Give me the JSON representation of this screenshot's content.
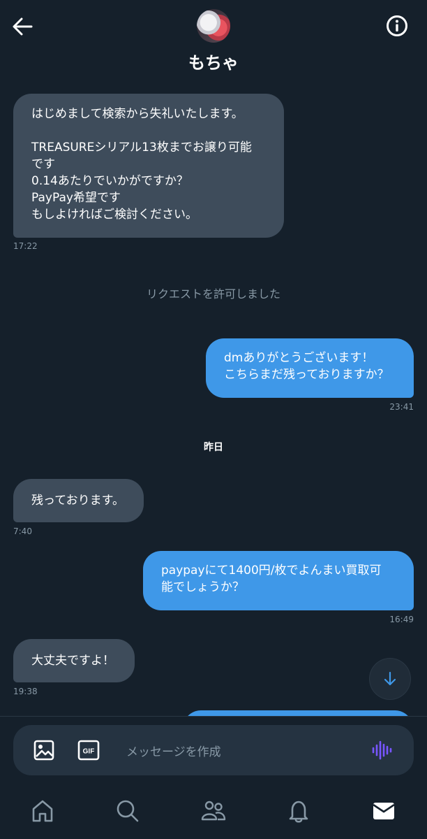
{
  "header": {
    "contact_name": "もちゃ"
  },
  "messages": [
    {
      "text": "はじめまして検索から失礼いたします。\n\nTREASUREシリアル13枚までお譲り可能\nです\n0.14あたりでいかがですか？\nPayPay希望です\nもしよければご検討ください。",
      "time": "17:22",
      "direction": "in"
    },
    {
      "text": "dmありがとうございます！\nこちらまだ残っておりますか？",
      "time": "23:41",
      "direction": "out"
    },
    {
      "text": "残っております。",
      "time": "7:40",
      "direction": "in"
    },
    {
      "text": "paypayにて1400円/枚でよんまい買取可\n能でしょうか？",
      "time": "16:49",
      "direction": "out"
    },
    {
      "text": "大丈夫ですよ！",
      "time": "19:38",
      "direction": "in"
    }
  ],
  "system_message": "リクエストを許可しました",
  "date_separator": "昨日",
  "composer": {
    "placeholder": "メッセージを作成",
    "gif_label": "GIF"
  },
  "icons": {
    "back": "arrow-left-icon",
    "info": "info-icon",
    "image": "image-icon",
    "gif": "gif-icon",
    "voice": "voice-icon",
    "scroll_down": "arrow-down-icon",
    "tabs": [
      "home-icon",
      "search-icon",
      "communities-icon",
      "notifications-icon",
      "messages-icon"
    ]
  },
  "colors": {
    "background": "#15202b",
    "incoming_bubble": "#3e4c5b",
    "outgoing_bubble": "#3f98e8",
    "muted_text": "#8899a6",
    "voice_accent": "#7856ff"
  }
}
